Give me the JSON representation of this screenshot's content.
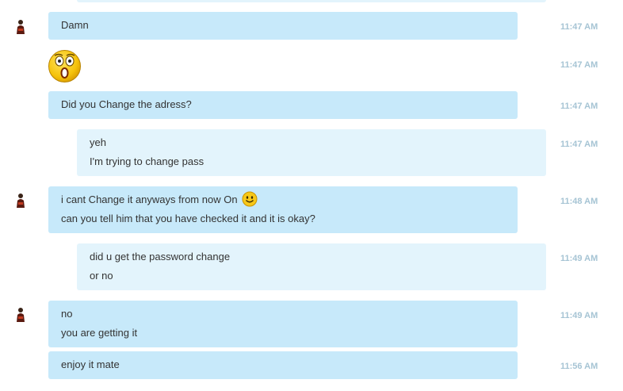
{
  "colors": {
    "incoming_bubble": "#c7e9fa",
    "outgoing_bubble": "#e3f4fc",
    "timestamp": "#a6c4d4"
  },
  "messages": [
    {
      "direction": "incoming",
      "avatar": true,
      "lines": [
        "Damn"
      ],
      "time": "11:47 AM"
    },
    {
      "direction": "incoming",
      "avatar": false,
      "emoji": "surprised-emoticon",
      "time": "11:47 AM"
    },
    {
      "direction": "incoming",
      "avatar": false,
      "lines": [
        "Did you Change the adress?"
      ],
      "time": "11:47 AM"
    },
    {
      "direction": "outgoing",
      "lines": [
        "yeh",
        "I'm trying to change pass"
      ],
      "time": "11:47 AM"
    },
    {
      "direction": "incoming",
      "avatar": true,
      "lines": [
        "i cant Change it anyways from now On",
        "can you tell him that you have checked it and it is okay?"
      ],
      "inline_emoji": "smile-emoticon",
      "time": "11:48 AM"
    },
    {
      "direction": "outgoing",
      "lines": [
        "did u get the password change",
        "or no"
      ],
      "time": "11:49 AM"
    },
    {
      "direction": "incoming",
      "avatar": true,
      "lines": [
        "no",
        "you are getting it"
      ],
      "time": "11:49 AM"
    },
    {
      "direction": "incoming",
      "avatar": false,
      "lines": [
        "enjoy it mate"
      ],
      "time": "11:56 AM"
    }
  ]
}
